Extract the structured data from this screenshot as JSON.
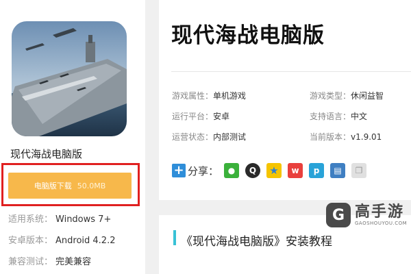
{
  "app": {
    "name": "现代海战电脑版",
    "download_label": "电脑版下载",
    "download_size": "50.0MB",
    "specs": [
      {
        "key": "适用系统：",
        "value": "Windows 7+"
      },
      {
        "key": "安卓版本：",
        "value": "Android 4.2.2"
      },
      {
        "key": "兼容测试：",
        "value": "完美兼容"
      }
    ]
  },
  "detail": {
    "title": "现代海战电脑版",
    "attributes": [
      {
        "key": "游戏属性：",
        "value": "单机游戏"
      },
      {
        "key": "游戏类型：",
        "value": "休闲益智"
      },
      {
        "key": "运行平台：",
        "value": "安卓"
      },
      {
        "key": "支持语言：",
        "value": "中文"
      },
      {
        "key": "运营状态：",
        "value": "内部测试"
      },
      {
        "key": "当前版本：",
        "value": "v1.9.01"
      }
    ],
    "share_label": "分享：",
    "share_icons": [
      "wechat-icon",
      "qq-icon",
      "qzone-icon",
      "weibo-icon",
      "tencent-weibo-icon",
      "print-icon",
      "copy-icon"
    ]
  },
  "section": {
    "title": "《现代海战电脑版》安装教程"
  },
  "brand": {
    "name": "高手游",
    "url": "GAOSHOUYOU.COM",
    "logo_glyph": "G"
  },
  "colors": {
    "download_button": "#f7b84b",
    "highlight_box": "#e02020",
    "section_accent": "#39c2d6",
    "share_plus": "#2f8ed9"
  }
}
